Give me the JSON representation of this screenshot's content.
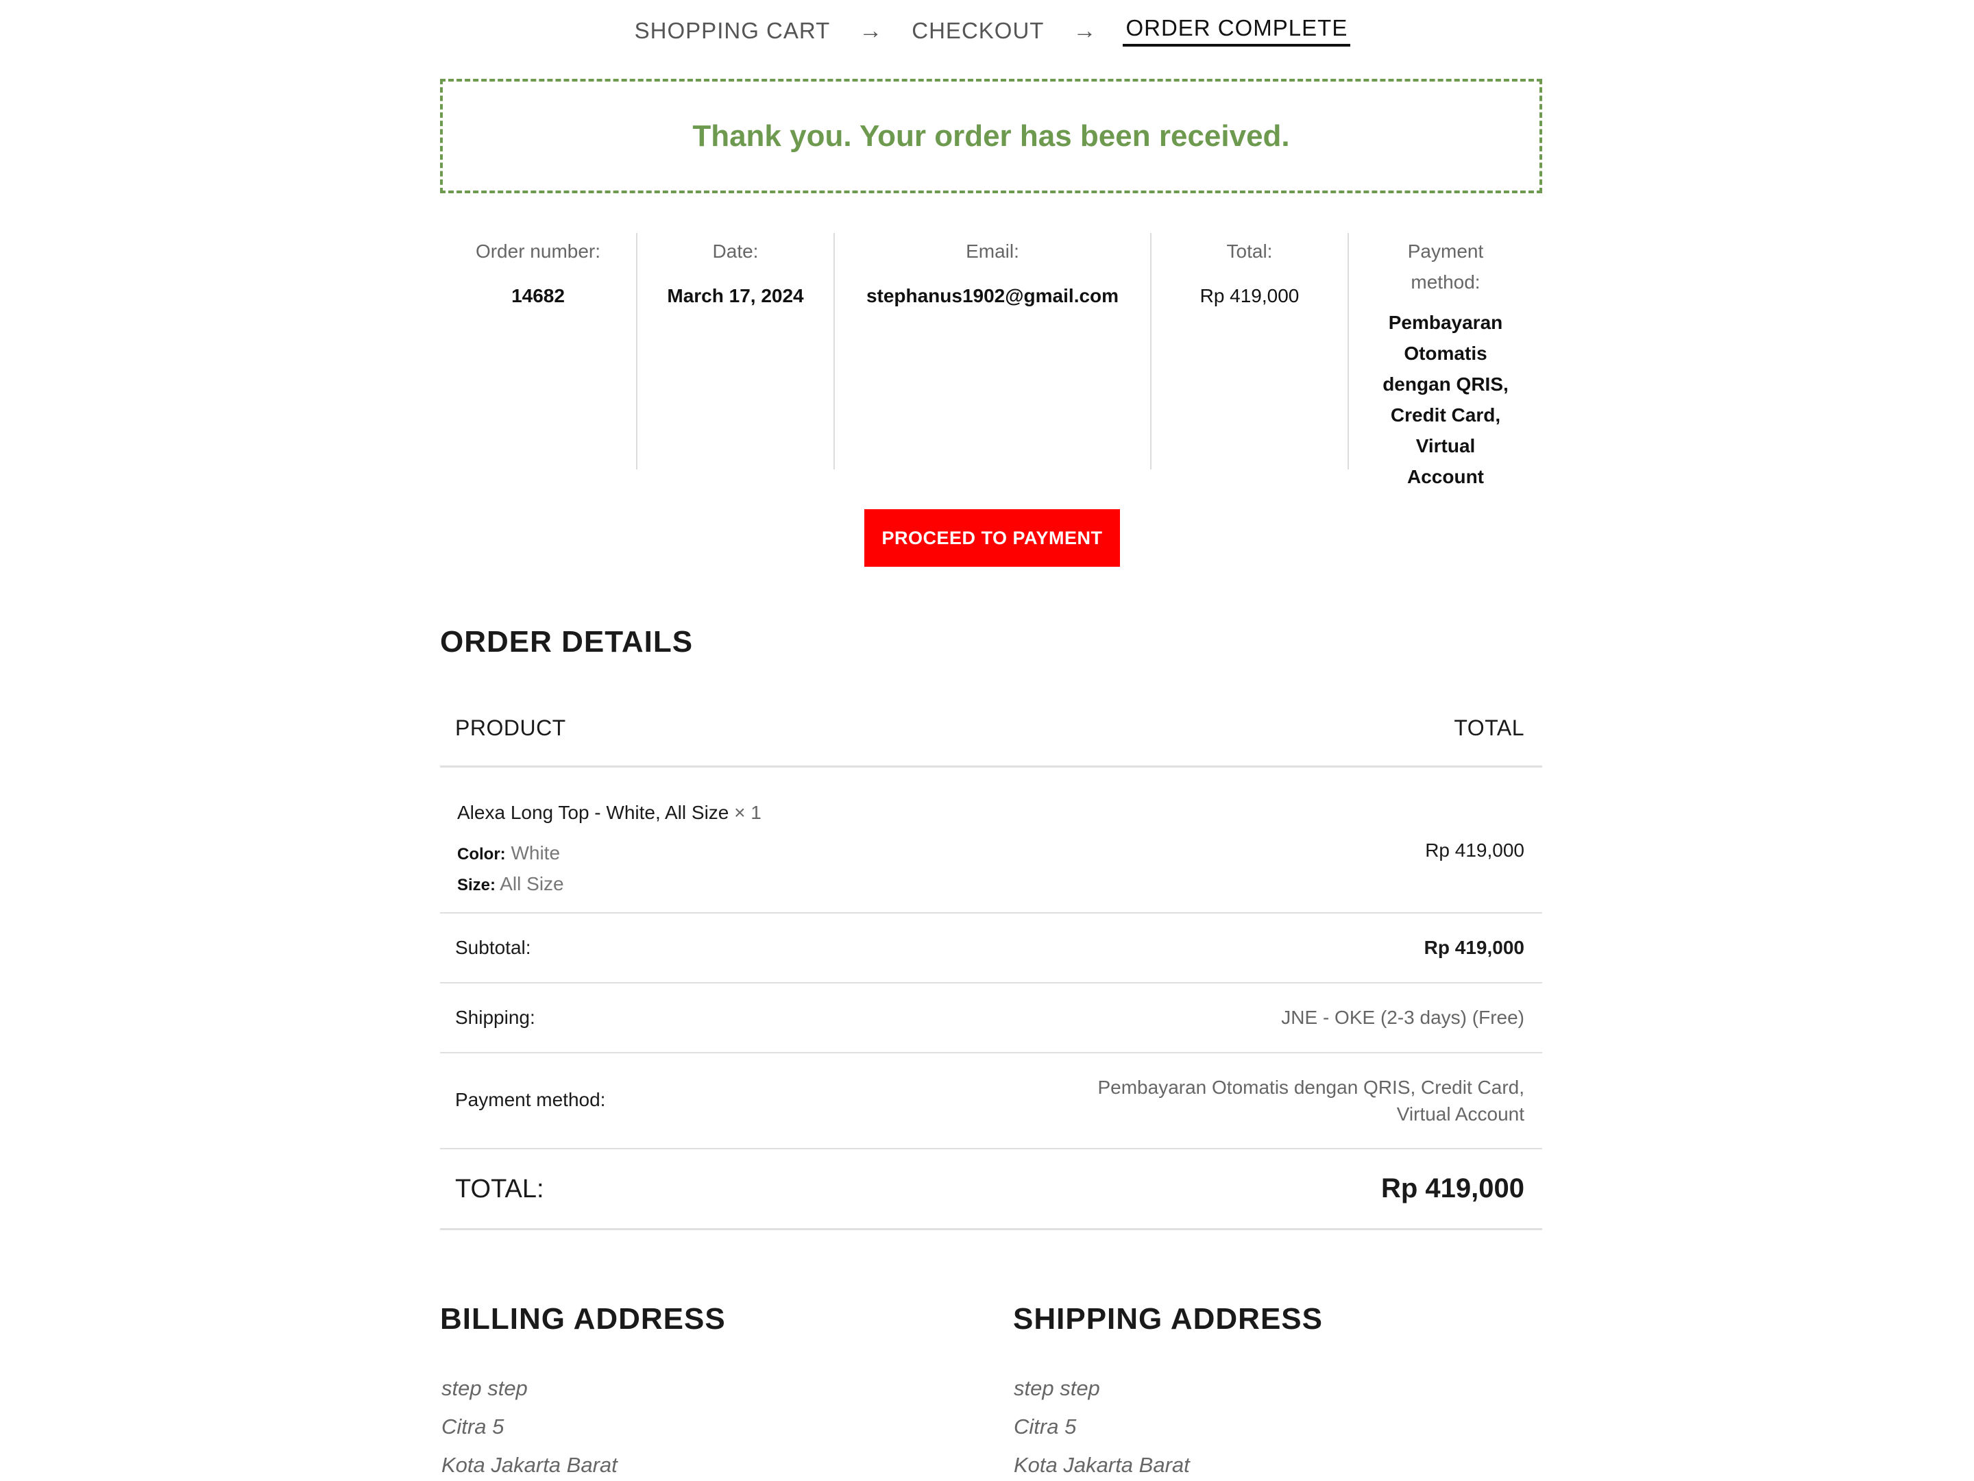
{
  "steps": {
    "cart": "SHOPPING CART",
    "checkout": "CHECKOUT",
    "complete": "ORDER COMPLETE",
    "arrow": "→"
  },
  "thanks_message": "Thank you. Your order has been received.",
  "overview": {
    "order_number_label": "Order number:",
    "order_number": "14682",
    "date_label": "Date:",
    "date": "March 17, 2024",
    "email_label": "Email:",
    "email": "stephanus1902@gmail.com",
    "total_label": "Total:",
    "total": "Rp 419,000",
    "payment_label_1": "Payment",
    "payment_label_2": "method:",
    "payment_lines": [
      "Pembayaran",
      "Otomatis",
      "dengan QRIS,",
      "Credit Card,",
      "Virtual",
      "Account"
    ]
  },
  "pay_button": "PROCEED TO PAYMENT",
  "order_details": {
    "title": "ORDER DETAILS",
    "col_product": "PRODUCT",
    "col_total": "TOTAL",
    "item": {
      "name": "Alexa Long Top - White, All Size",
      "qty": "× 1",
      "color_label": "Color:",
      "color": "White",
      "size_label": "Size:",
      "size": "All Size",
      "total": "Rp 419,000"
    },
    "subtotal_label": "Subtotal:",
    "subtotal": "Rp 419,000",
    "shipping_label": "Shipping:",
    "shipping": "JNE - OKE (2-3 days) (Free)",
    "payment_label": "Payment method:",
    "payment_line_1": "Pembayaran Otomatis dengan QRIS, Credit Card,",
    "payment_line_2": "Virtual Account",
    "total_label": "TOTAL:",
    "total": "Rp 419,000"
  },
  "billing": {
    "title": "BILLING ADDRESS",
    "lines": [
      "step step",
      "Citra 5",
      "Kota Jakarta Barat"
    ]
  },
  "shipping": {
    "title": "SHIPPING ADDRESS",
    "lines": [
      "step step",
      "Citra 5",
      "Kota Jakarta Barat"
    ]
  },
  "colors": {
    "success_green": "#6e9a4f",
    "button_red": "#ff0000"
  }
}
